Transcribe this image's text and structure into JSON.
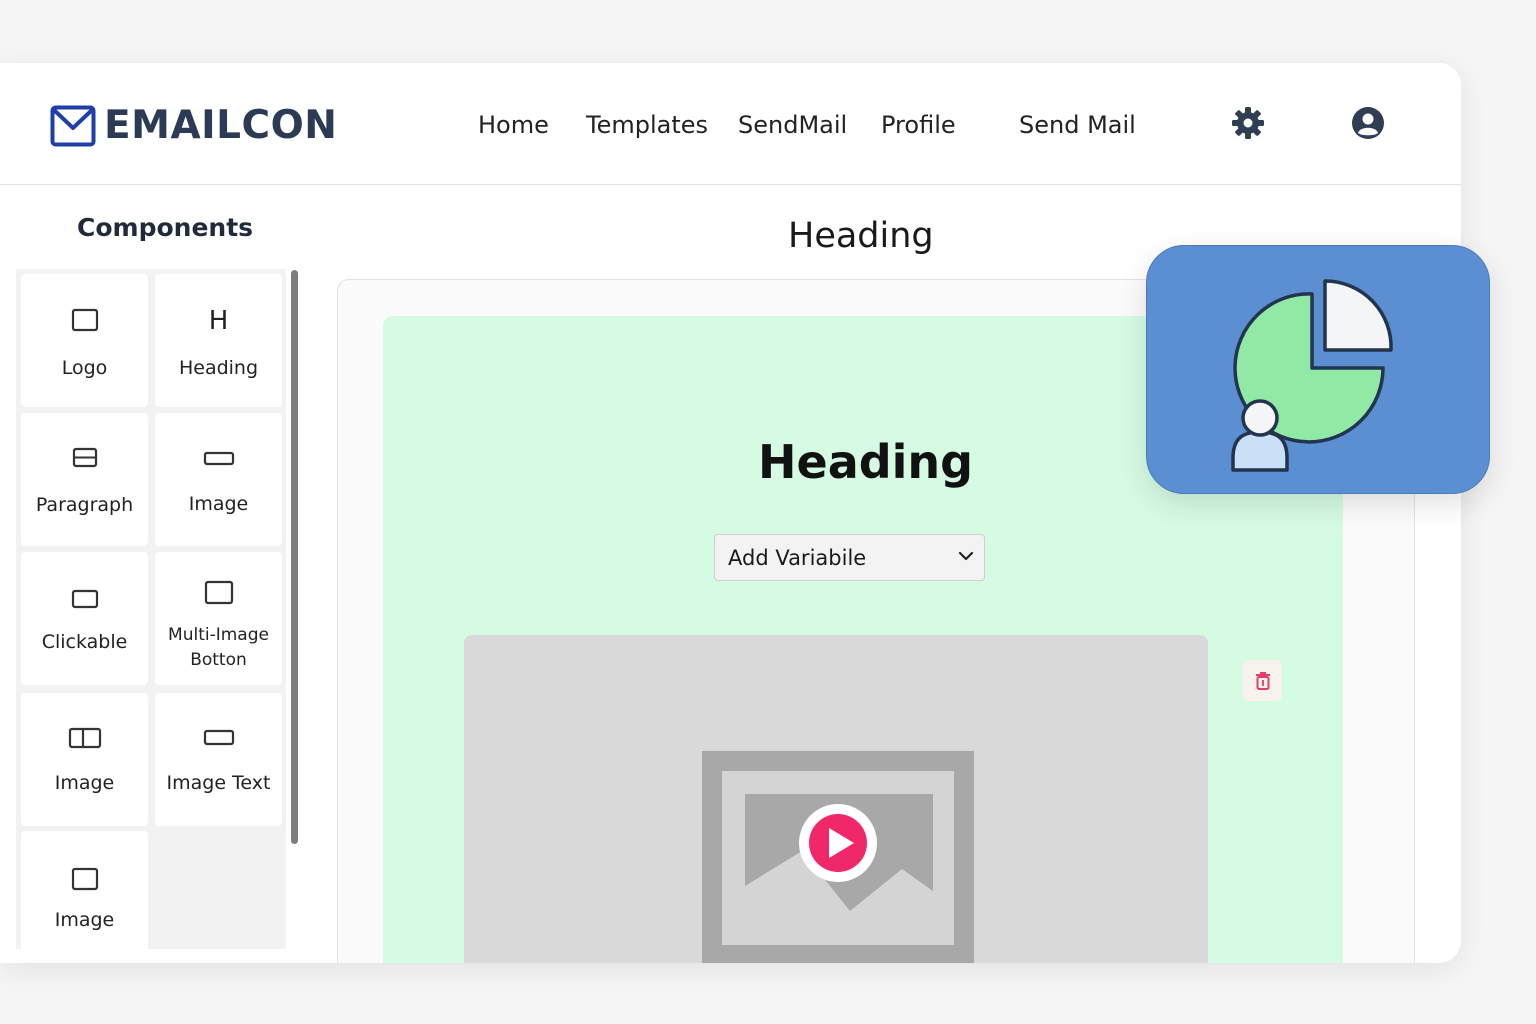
{
  "brand": {
    "name": "EMAILCON",
    "logo_icon": "envelope-icon",
    "accent": "#1f3fa8"
  },
  "nav": {
    "items": [
      "Home",
      "Templates",
      "SendMail",
      "Profile",
      "Send Mail"
    ],
    "settings_icon": "gear-icon",
    "profile_icon": "user-circle-icon"
  },
  "sidebar": {
    "title": "Components",
    "components": [
      {
        "label": "Logo",
        "icon": "square-icon"
      },
      {
        "label": "Heading",
        "icon": "H"
      },
      {
        "label": "Paragraph",
        "icon": "paragraph-block-icon"
      },
      {
        "label": "Image",
        "icon": "wide-rect-icon"
      },
      {
        "label": "Clickable",
        "icon": "button-rect-icon"
      },
      {
        "label": "Multi-Image Botton",
        "label_line1": "Multi-Image",
        "label_line2": "Botton",
        "icon": "square-icon"
      },
      {
        "label": "Image",
        "icon": "split-rect-icon"
      },
      {
        "label": "Image Text",
        "icon": "wide-rect-icon"
      },
      {
        "label": "Image",
        "icon": "square-icon"
      }
    ]
  },
  "canvas": {
    "title": "Heading",
    "email_heading": "Heading",
    "variable_select": {
      "value": "Add Variabile"
    },
    "media": {
      "icon": "video-play-icon",
      "play_color": "#f0286a"
    },
    "delete_icon": "trash-icon",
    "background": "#d6fbe3"
  },
  "floating_card": {
    "icon": "pie-chart-user-icon",
    "background": "#5b8fd1",
    "pie_color": "#90eaa6"
  }
}
